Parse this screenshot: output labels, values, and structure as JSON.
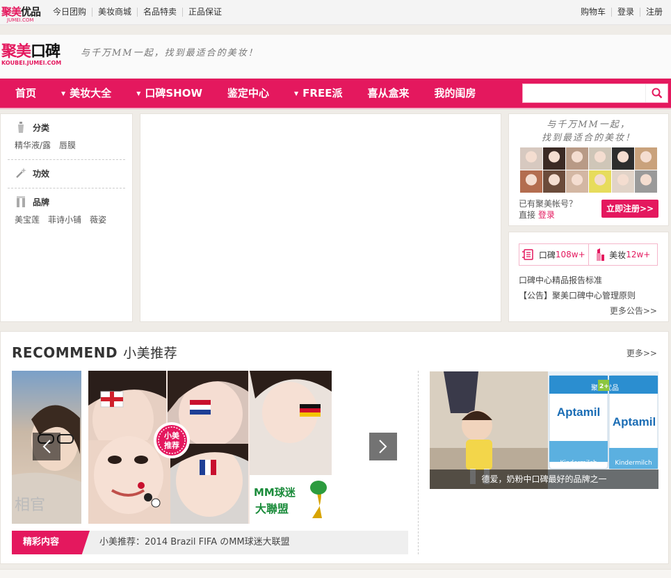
{
  "topbar": {
    "logo_main": "聚美",
    "logo_main_suffix": "优品",
    "logo_sub": "JUMEI.COM",
    "links": [
      "今日团购",
      "美妆商城",
      "名品特卖",
      "正品保证"
    ],
    "right_links": [
      "购物车",
      "登录",
      "注册"
    ]
  },
  "header": {
    "logo_main": "聚美",
    "logo_main_suffix": "口碑",
    "logo_sub": "KOUBEI.JUMEI.COM",
    "slogan": "与千万MM一起，找到最适合的美妆！"
  },
  "nav": {
    "items": [
      {
        "label": "首页",
        "caret": false
      },
      {
        "label": "美妆大全",
        "caret": true
      },
      {
        "label": "口碑SHOW",
        "caret": true
      },
      {
        "label": "鉴定中心",
        "caret": false
      },
      {
        "label": "FREE派",
        "caret": true
      },
      {
        "label": "喜从盒来",
        "caret": false
      },
      {
        "label": "我的闺房",
        "caret": false
      }
    ],
    "search_placeholder": "",
    "accent": "#e4185e"
  },
  "left_panel": {
    "sections": [
      {
        "title": "分类",
        "icon": "bottle-icon",
        "items": [
          "精华液/露",
          "唇膜"
        ]
      },
      {
        "title": "功效",
        "icon": "wand-icon",
        "items": []
      },
      {
        "title": "品牌",
        "icon": "brand-icon",
        "items": [
          "美宝莲",
          "菲诗小铺",
          "薇姿"
        ]
      }
    ]
  },
  "right_top": {
    "slogan_line1": "与千万MM一起，",
    "slogan_line2": "找到最适合的美妆！",
    "has_account": "已有聚美帐号？",
    "direct": "直接",
    "login": "登录",
    "register_btn": "立即注册>>"
  },
  "right_bottom": {
    "stat1_label": "口碑",
    "stat1_value": "108w+",
    "stat2_label": "美妆",
    "stat2_value": "12w+",
    "notice1": "口碑中心精品报告标准",
    "notice2": "【公告】聚美口碑中心管理原则",
    "more": "更多公告>>"
  },
  "recommend": {
    "title_en": "RECOMMEND",
    "title_cn": "小美推荐",
    "more": "更多>>",
    "badge": "小美推荐",
    "badge_line1": "小美",
    "badge_line2": "推荐",
    "promo_text1": "MM球迷",
    "promo_text2": "大聯盟",
    "caption_tag": "精彩内容",
    "caption": "小美推荐：2014 Brazil FIFA のMM球迷大联盟",
    "side_caption": "德爱，奶粉中口碑最好的品牌之一",
    "milk_brand": "Aptamil",
    "milk_sub": "Kindermilch",
    "milk_stage": "2+",
    "shop_label": "聚美优品"
  }
}
